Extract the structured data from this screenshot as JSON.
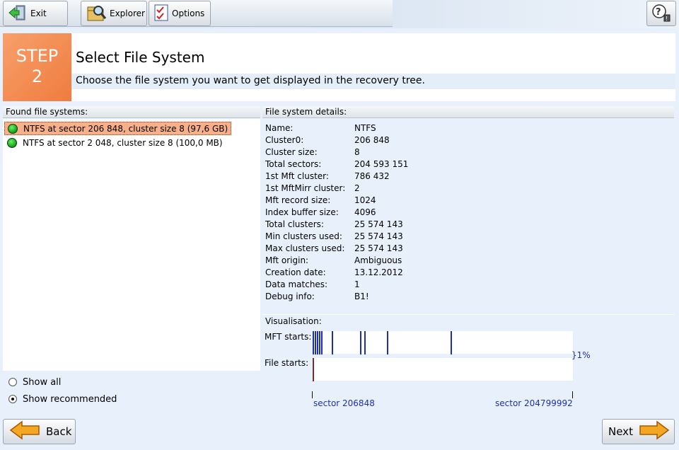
{
  "toolbar": {
    "exit_label": "Exit",
    "explorer_label": "Explorer",
    "options_label": "Options"
  },
  "step": {
    "word": "STEP",
    "number": "2"
  },
  "header": {
    "title": "Select File System",
    "subtitle": "Choose the file system you want to get displayed in the recovery tree."
  },
  "found": {
    "header": "Found file systems:",
    "items": [
      {
        "label": "NTFS at sector 206 848, cluster size 8 (97,6 GB)",
        "selected": true
      },
      {
        "label": "NTFS at sector 2 048, cluster size 8 (100,0 MB)",
        "selected": false
      }
    ]
  },
  "filter": {
    "show_all": "Show all",
    "show_recommended": "Show recommended",
    "selected": "show_recommended"
  },
  "details": {
    "header": "File system details:",
    "rows": [
      {
        "key": "Name:",
        "value": "NTFS"
      },
      {
        "key": "Cluster0:",
        "value": "206 848"
      },
      {
        "key": "Cluster size:",
        "value": "8"
      },
      {
        "key": "Total sectors:",
        "value": "204 593 151"
      },
      {
        "key": " 1st Mft cluster:",
        "value": "786 432"
      },
      {
        "key": " 1st MftMirr cluster:",
        "value": "2"
      },
      {
        "key": "Mft record size:",
        "value": "1024"
      },
      {
        "key": "Index buffer size:",
        "value": "4096"
      },
      {
        "key": "Total clusters:",
        "value": "25 574 143"
      },
      {
        "key": "Min clusters used:",
        "value": "25 574 143"
      },
      {
        "key": "Max clusters used:",
        "value": "25 574 143"
      },
      {
        "key": "Mft origin:",
        "value": "Ambiguous"
      },
      {
        "key": "Creation date:",
        "value": "13.12.2012"
      },
      {
        "key": "Data matches:",
        "value": "1"
      },
      {
        "key": "Debug info:",
        "value": "B1!"
      }
    ]
  },
  "visualisation": {
    "header": "Visualisation:",
    "mft_label": "MFT starts:",
    "file_label": "File starts:",
    "percent": "}1%",
    "sector_start": "sector 206848",
    "sector_end": "sector 204799992",
    "mft_marks": [
      0,
      0.008,
      0.017,
      0.025,
      0.033,
      0.074,
      0.182,
      0.199,
      0.286,
      0.529
    ],
    "file_marks": [
      0
    ]
  },
  "nav": {
    "back_label": "Back",
    "next_label": "Next"
  },
  "colors": {
    "step_orange": "#ef7c3f",
    "selection": "#f7b08a",
    "mark_blue": "#1c2fb4"
  }
}
